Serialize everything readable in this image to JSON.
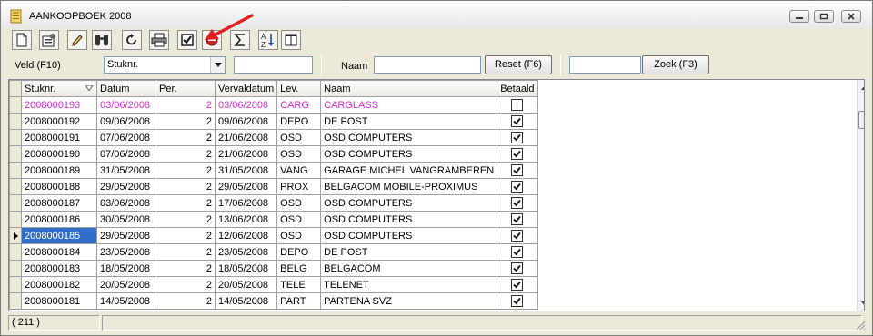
{
  "window": {
    "title": "AANKOOPBOEK 2008"
  },
  "toolbar": {
    "buttons": [
      {
        "name": "new-doc-icon"
      },
      {
        "name": "properties-icon"
      },
      {
        "name": "edit-pencil-icon"
      },
      {
        "name": "find-binoculars-icon"
      },
      {
        "name": "refresh-icon"
      },
      {
        "name": "print-icon"
      },
      {
        "name": "checkbox-icon"
      },
      {
        "name": "delete-circle-icon"
      },
      {
        "name": "sum-sigma-icon"
      },
      {
        "name": "sort-az-icon"
      },
      {
        "name": "columns-icon"
      }
    ],
    "annotation": {
      "name": "red-arrow-annotation",
      "color": "#e02020"
    }
  },
  "filter": {
    "field_label": "Veld (F10)",
    "field_select": "Stuknr.",
    "field_value": "",
    "name_label": "Naam",
    "name_value": "",
    "reset_label": "Reset (F6)",
    "search_value": "",
    "search_label": "Zoek (F3)"
  },
  "grid": {
    "columns": [
      "Stuknr.",
      "Datum",
      "Per.",
      "Vervaldatum",
      "Lev.",
      "Naam",
      "Betaald"
    ],
    "rows": [
      {
        "stuknr": "2008000193",
        "datum": "03/06/2008",
        "per": "2",
        "verval": "03/06/2008",
        "lev": "CARG",
        "naam": "CARGLASS",
        "betaald": false,
        "highlight": true,
        "current": false
      },
      {
        "stuknr": "2008000192",
        "datum": "09/06/2008",
        "per": "2",
        "verval": "09/06/2008",
        "lev": "DEPO",
        "naam": "DE POST",
        "betaald": true,
        "highlight": false,
        "current": false
      },
      {
        "stuknr": "2008000191",
        "datum": "07/06/2008",
        "per": "2",
        "verval": "21/06/2008",
        "lev": "OSD",
        "naam": "OSD COMPUTERS",
        "betaald": true,
        "highlight": false,
        "current": false
      },
      {
        "stuknr": "2008000190",
        "datum": "07/06/2008",
        "per": "2",
        "verval": "21/06/2008",
        "lev": "OSD",
        "naam": "OSD COMPUTERS",
        "betaald": true,
        "highlight": false,
        "current": false
      },
      {
        "stuknr": "2008000189",
        "datum": "31/05/2008",
        "per": "2",
        "verval": "31/05/2008",
        "lev": "VANG",
        "naam": "GARAGE MICHEL VANGRAMBEREN",
        "betaald": true,
        "highlight": false,
        "current": false
      },
      {
        "stuknr": "2008000188",
        "datum": "29/05/2008",
        "per": "2",
        "verval": "29/05/2008",
        "lev": "PROX",
        "naam": "BELGACOM MOBILE-PROXIMUS",
        "betaald": true,
        "highlight": false,
        "current": false
      },
      {
        "stuknr": "2008000187",
        "datum": "03/06/2008",
        "per": "2",
        "verval": "17/06/2008",
        "lev": "OSD",
        "naam": "OSD COMPUTERS",
        "betaald": true,
        "highlight": false,
        "current": false
      },
      {
        "stuknr": "2008000186",
        "datum": "30/05/2008",
        "per": "2",
        "verval": "13/06/2008",
        "lev": "OSD",
        "naam": "OSD COMPUTERS",
        "betaald": true,
        "highlight": false,
        "current": false
      },
      {
        "stuknr": "2008000185",
        "datum": "29/05/2008",
        "per": "2",
        "verval": "12/06/2008",
        "lev": "OSD",
        "naam": "OSD COMPUTERS",
        "betaald": true,
        "highlight": false,
        "current": true
      },
      {
        "stuknr": "2008000184",
        "datum": "23/05/2008",
        "per": "2",
        "verval": "23/05/2008",
        "lev": "DEPO",
        "naam": "DE POST",
        "betaald": true,
        "highlight": false,
        "current": false
      },
      {
        "stuknr": "2008000183",
        "datum": "18/05/2008",
        "per": "2",
        "verval": "18/05/2008",
        "lev": "BELG",
        "naam": "BELGACOM",
        "betaald": true,
        "highlight": false,
        "current": false
      },
      {
        "stuknr": "2008000182",
        "datum": "20/05/2008",
        "per": "2",
        "verval": "20/05/2008",
        "lev": "TELE",
        "naam": "TELENET",
        "betaald": true,
        "highlight": false,
        "current": false
      },
      {
        "stuknr": "2008000181",
        "datum": "14/05/2008",
        "per": "2",
        "verval": "14/05/2008",
        "lev": "PART",
        "naam": "PARTENA SVZ",
        "betaald": true,
        "highlight": false,
        "current": false
      }
    ]
  },
  "status": {
    "count": "( 211 )"
  },
  "colors": {
    "highlight_text": "#d42fd4",
    "selection": "#2f6ec9"
  }
}
